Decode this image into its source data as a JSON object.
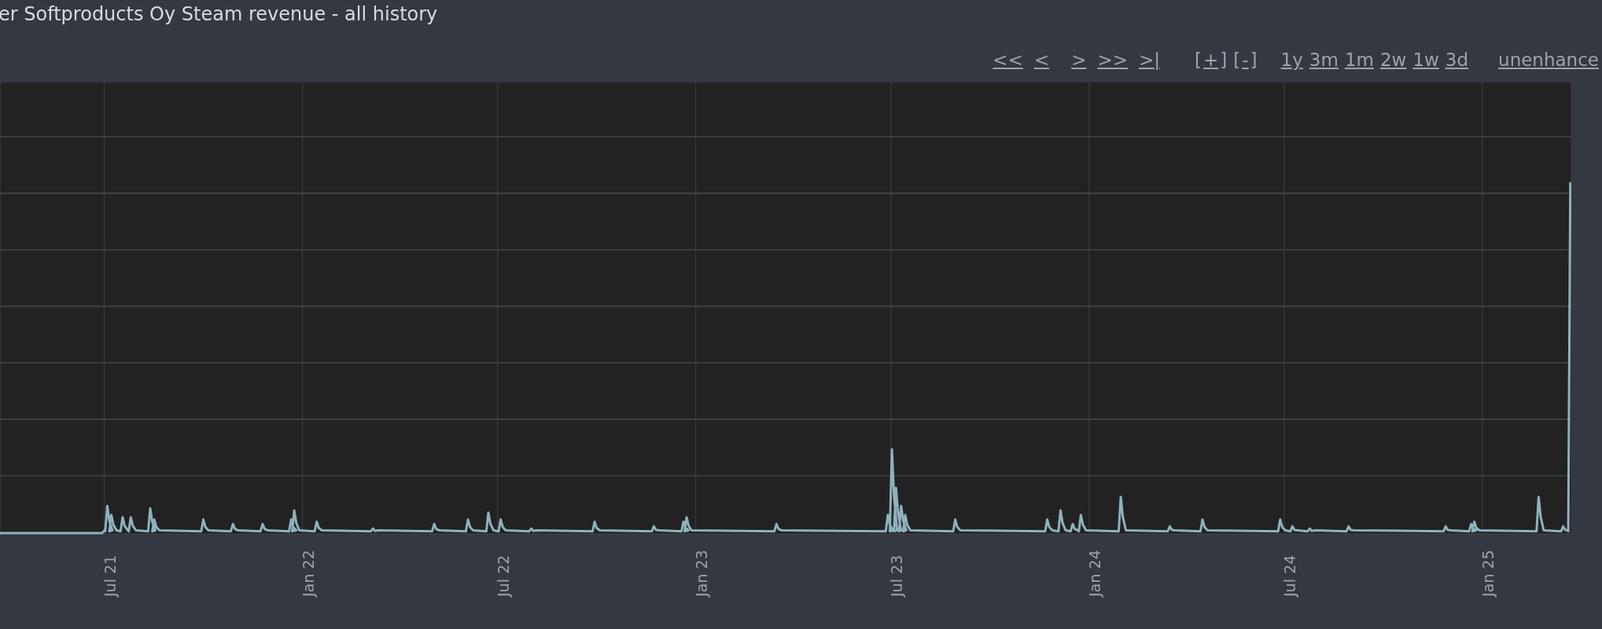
{
  "title": "er Softproducts Oy Steam revenue - all history",
  "controls": {
    "navigation": [
      {
        "label": "<<"
      },
      {
        "label": "<"
      },
      {
        "label": ">"
      },
      {
        "label": ">>"
      },
      {
        "label": ">|"
      }
    ],
    "zoom": [
      {
        "open": "[",
        "label": "+",
        "close": "]"
      },
      {
        "open": "[",
        "label": "-",
        "close": "]"
      }
    ],
    "ranges": [
      "1y",
      "3m",
      "1m",
      "2w",
      "1w",
      "3d"
    ],
    "enhance": "unenhance"
  },
  "chart": {
    "x_labels": [
      "Jul 21",
      "Jan 22",
      "Jul 22",
      "Jan 23",
      "Jul 23",
      "Jan 24",
      "Jul 24",
      "Jan 25"
    ]
  }
}
